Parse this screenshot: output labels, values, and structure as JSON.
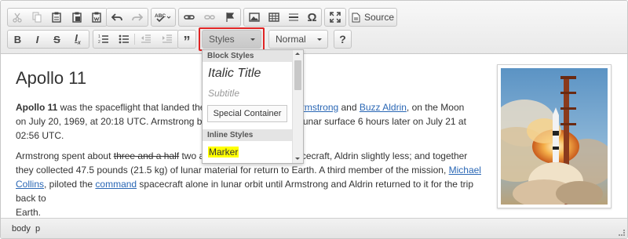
{
  "toolbar": {
    "source_label": "Source",
    "styles_combo": "Styles",
    "format_combo": "Normal",
    "help_label": "?"
  },
  "dropdown": {
    "block_header": "Block Styles",
    "items": [
      "Italic Title",
      "Subtitle",
      "Special Container"
    ],
    "inline_header": "Inline Styles",
    "marker": "Marker"
  },
  "document": {
    "title": "Apollo 11",
    "p1": {
      "bold": "Apollo 11",
      "t1": " was the spaceflight that landed the f",
      "link1": "eil Armstrong",
      "t2": " and ",
      "link2": "Buzz Aldrin",
      "t3": ", on the Moon",
      "line2a": "on July 20, 1969, at 20:18 UTC. Armstrong bec",
      "line2b": "the lunar surface 6 hours later on July 21 at",
      "line3": "02:56 UTC."
    },
    "p2": {
      "t1": "Armstrong spent about ",
      "strike": "three and a half",
      "t2": " two and",
      "t3": "pacecraft, Aldrin slightly less; and together",
      "line2": "they collected 47.5 pounds (21.5 kg) of lunar material for return to Earth. A third member of the mission, ",
      "link1": "Michael",
      "link1b": "Collins",
      "line3a": ", piloted the ",
      "link2": "command",
      "line3b": " spacecraft alone in lunar orbit until Armstrong and Aldrin returned to it for the trip back to",
      "line4": "Earth."
    }
  },
  "statusbar": {
    "path": [
      "body",
      "p"
    ]
  },
  "icons": {
    "cut": "cut-icon",
    "copy": "copy-icon",
    "paste": "paste-icon",
    "paste_text": "paste-text-icon",
    "paste_word": "paste-from-word-icon",
    "undo": "undo-icon",
    "redo": "redo-icon",
    "spellcheck": "spellcheck-icon",
    "link": "link-icon",
    "unlink": "unlink-icon",
    "anchor": "anchor-flag-icon",
    "image": "image-icon",
    "table": "table-icon",
    "hr": "horizontal-line-icon",
    "special_char": "omega-icon",
    "maximize": "maximize-icon",
    "source": "source-icon",
    "bold": "bold-icon",
    "italic": "italic-icon",
    "strike": "strikethrough-icon",
    "remove_format": "remove-format-icon",
    "ol": "numbered-list-icon",
    "ul": "bulleted-list-icon",
    "outdent": "outdent-icon",
    "indent": "indent-icon",
    "blockquote": "blockquote-icon"
  },
  "colors": {
    "link": "#2a67b5",
    "highlight_border": "#e02424",
    "marker": "#ffff00"
  }
}
